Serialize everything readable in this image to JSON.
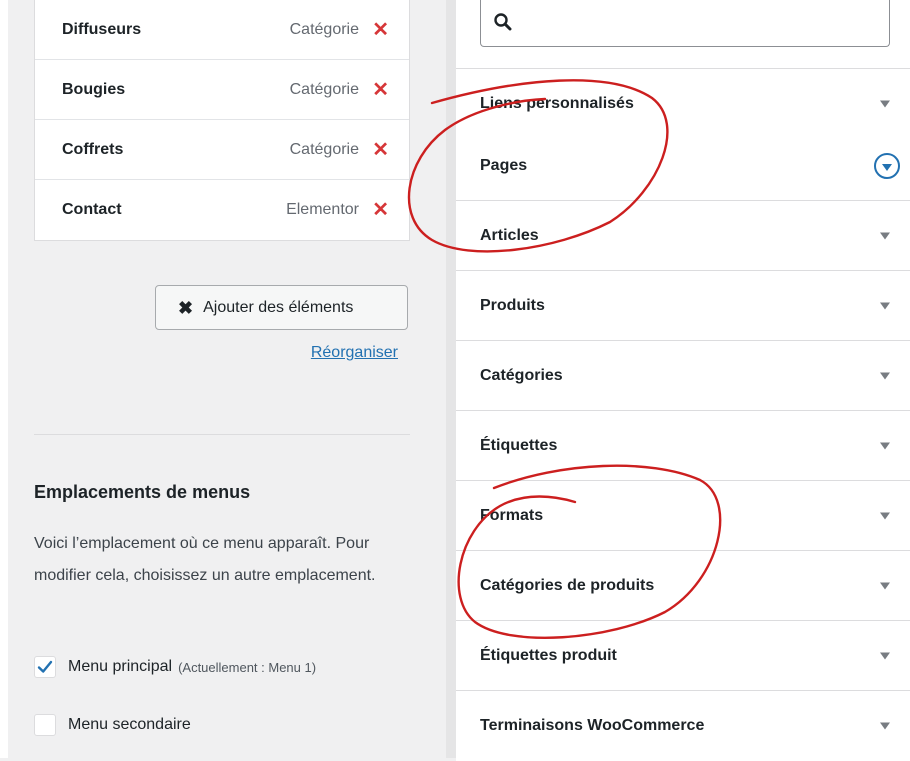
{
  "menu_items": [
    {
      "title": "Diffuseurs",
      "type": "Catégorie"
    },
    {
      "title": "Bougies",
      "type": "Catégorie"
    },
    {
      "title": "Coffrets",
      "type": "Catégorie"
    },
    {
      "title": "Contact",
      "type": "Elementor"
    }
  ],
  "delete_icon": "✕",
  "add_button": {
    "icon": "✖",
    "label": "Ajouter des éléments"
  },
  "reorganize_link": "Réorganiser",
  "locations": {
    "heading": "Emplacements de menus",
    "description": "Voici l’emplacement où ce menu apparaît. Pour modifier cela, choisissez un autre emplacement.",
    "options": [
      {
        "label": "Menu principal",
        "note": "(Actuellement : Menu 1)",
        "checked": true
      },
      {
        "label": "Menu secondaire",
        "note": "",
        "checked": false
      }
    ]
  },
  "accordion": [
    {
      "title": "Liens personnalisés",
      "arrow_style": "plain"
    },
    {
      "title": "Pages",
      "arrow_style": "circle"
    },
    {
      "title": "Articles",
      "arrow_style": "plain"
    },
    {
      "title": "Produits",
      "arrow_style": "plain"
    },
    {
      "title": "Catégories",
      "arrow_style": "plain"
    },
    {
      "title": "Étiquettes",
      "arrow_style": "plain"
    },
    {
      "title": "Formats",
      "arrow_style": "plain"
    },
    {
      "title": "Catégories de produits",
      "arrow_style": "plain"
    },
    {
      "title": "Étiquettes produit",
      "arrow_style": "plain"
    },
    {
      "title": "Terminaisons WooCommerce",
      "arrow_style": "plain"
    }
  ],
  "colors": {
    "delete": "#d63638",
    "link": "#2271b1",
    "annotation": "#cc1f1f",
    "check": "#2271b1"
  },
  "icons": {
    "search": "search-icon",
    "expand": "chevron-down-icon",
    "checkbox": "checkmark-icon"
  }
}
